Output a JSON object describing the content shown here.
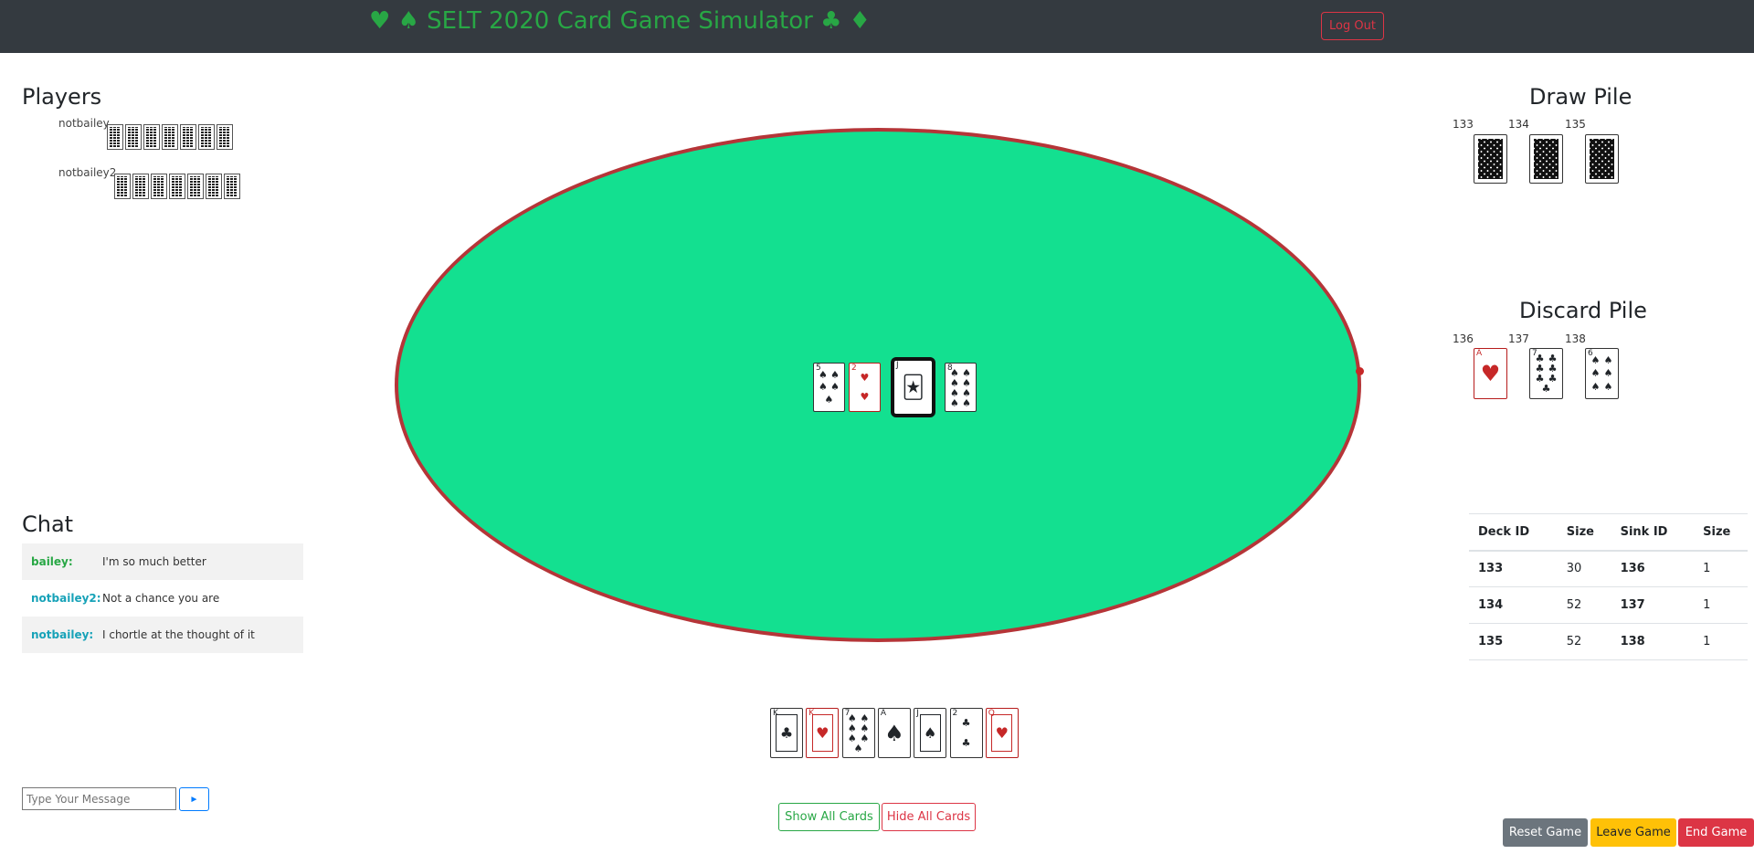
{
  "header": {
    "title": "♥ ♠ SELT 2020 Card Game Simulator ♣ ♦",
    "logout_label": "Log Out"
  },
  "players": {
    "heading": "Players",
    "list": [
      {
        "name": "notbailey",
        "card_count": 7
      },
      {
        "name": "notbailey2",
        "card_count": 7
      }
    ]
  },
  "draw_pile": {
    "heading": "Draw Pile",
    "ids": [
      "133",
      "134",
      "135"
    ]
  },
  "discard_pile": {
    "heading": "Discard Pile",
    "ids": [
      "136",
      "137",
      "138"
    ],
    "cards": [
      {
        "rank": "A",
        "suit": "♥",
        "color": "red"
      },
      {
        "rank": "7",
        "suit": "♣",
        "color": "black"
      },
      {
        "rank": "6",
        "suit": "♠",
        "color": "black"
      }
    ]
  },
  "table_cards": [
    {
      "rank": "5",
      "suit": "♠",
      "color": "black"
    },
    {
      "rank": "2",
      "suit": "♥",
      "color": "red"
    },
    {
      "rank": "J",
      "suit": "joker",
      "color": "black"
    },
    {
      "rank": "8",
      "suit": "♠",
      "color": "black"
    }
  ],
  "hand_cards": [
    {
      "rank": "K",
      "suit": "♣",
      "color": "black",
      "face": true
    },
    {
      "rank": "K",
      "suit": "♥",
      "color": "red",
      "face": true
    },
    {
      "rank": "7",
      "suit": "♠",
      "color": "black"
    },
    {
      "rank": "A",
      "suit": "♠",
      "color": "black"
    },
    {
      "rank": "J",
      "suit": "♠",
      "color": "black",
      "face": true
    },
    {
      "rank": "2",
      "suit": "♣",
      "color": "black"
    },
    {
      "rank": "Q",
      "suit": "♥",
      "color": "red",
      "face": true
    }
  ],
  "deck_table": {
    "headers": [
      "Deck ID",
      "Size",
      "Sink ID",
      "Size"
    ],
    "rows": [
      [
        "133",
        "30",
        "136",
        "1"
      ],
      [
        "134",
        "52",
        "137",
        "1"
      ],
      [
        "135",
        "52",
        "138",
        "1"
      ]
    ]
  },
  "chat": {
    "heading": "Chat",
    "messages": [
      {
        "user": "bailey:",
        "text": "I'm so much better",
        "color": "#28a745"
      },
      {
        "user": "notbailey2:",
        "text": "Not a chance you are",
        "color": "#17a2b8"
      },
      {
        "user": "notbailey:",
        "text": "I chortle at the thought of it",
        "color": "#17a2b8"
      }
    ],
    "input_placeholder": "Type Your Message",
    "send_label": "►"
  },
  "buttons": {
    "show_all": "Show All Cards",
    "hide_all": "Hide All Cards",
    "reset": "Reset Game",
    "leave": "Leave Game",
    "end": "End Game"
  },
  "colors": {
    "table_felt": "#13e090",
    "table_rim": "#b53538",
    "topbar": "#343a40",
    "title": "#28a745"
  }
}
